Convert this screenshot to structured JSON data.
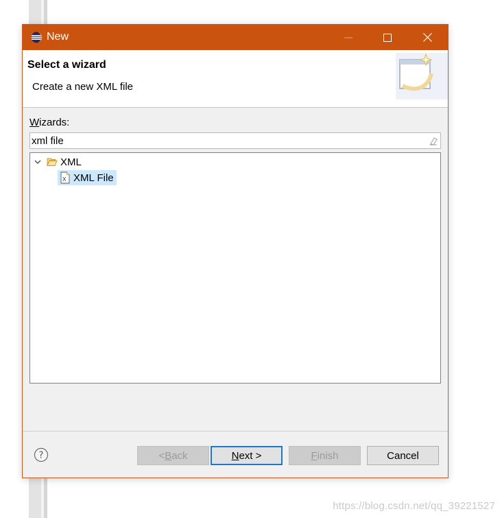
{
  "background": {
    "watermark": "https://blog.csdn.net/qq_39221527"
  },
  "window": {
    "title": "New",
    "accent_color": "#c9530f",
    "controls": {
      "minimize_icon": "minimize-icon",
      "maximize_icon": "maximize-icon",
      "close_icon": "close-icon"
    }
  },
  "header": {
    "title": "Select a wizard",
    "description": "Create a new XML file",
    "graphic_icon": "new-wizard-banner-icon"
  },
  "wizards": {
    "label_mnemonic": "W",
    "label_rest": "izards:",
    "filter_value": "xml file",
    "tree": [
      {
        "label": "XML",
        "expanded": true,
        "icon": "folder-open-icon",
        "children": [
          {
            "label": "XML File",
            "icon": "xml-file-icon",
            "selected": true
          }
        ]
      }
    ]
  },
  "footer": {
    "help_icon": "help-icon",
    "back": {
      "pre": "< ",
      "mnemonic": "B",
      "rest": "ack",
      "enabled": false
    },
    "next": {
      "mnemonic": "N",
      "rest": "ext >",
      "enabled": true
    },
    "finish": {
      "mnemonic": "F",
      "rest": "inish",
      "enabled": false
    },
    "cancel": {
      "label": "Cancel",
      "enabled": true
    }
  }
}
